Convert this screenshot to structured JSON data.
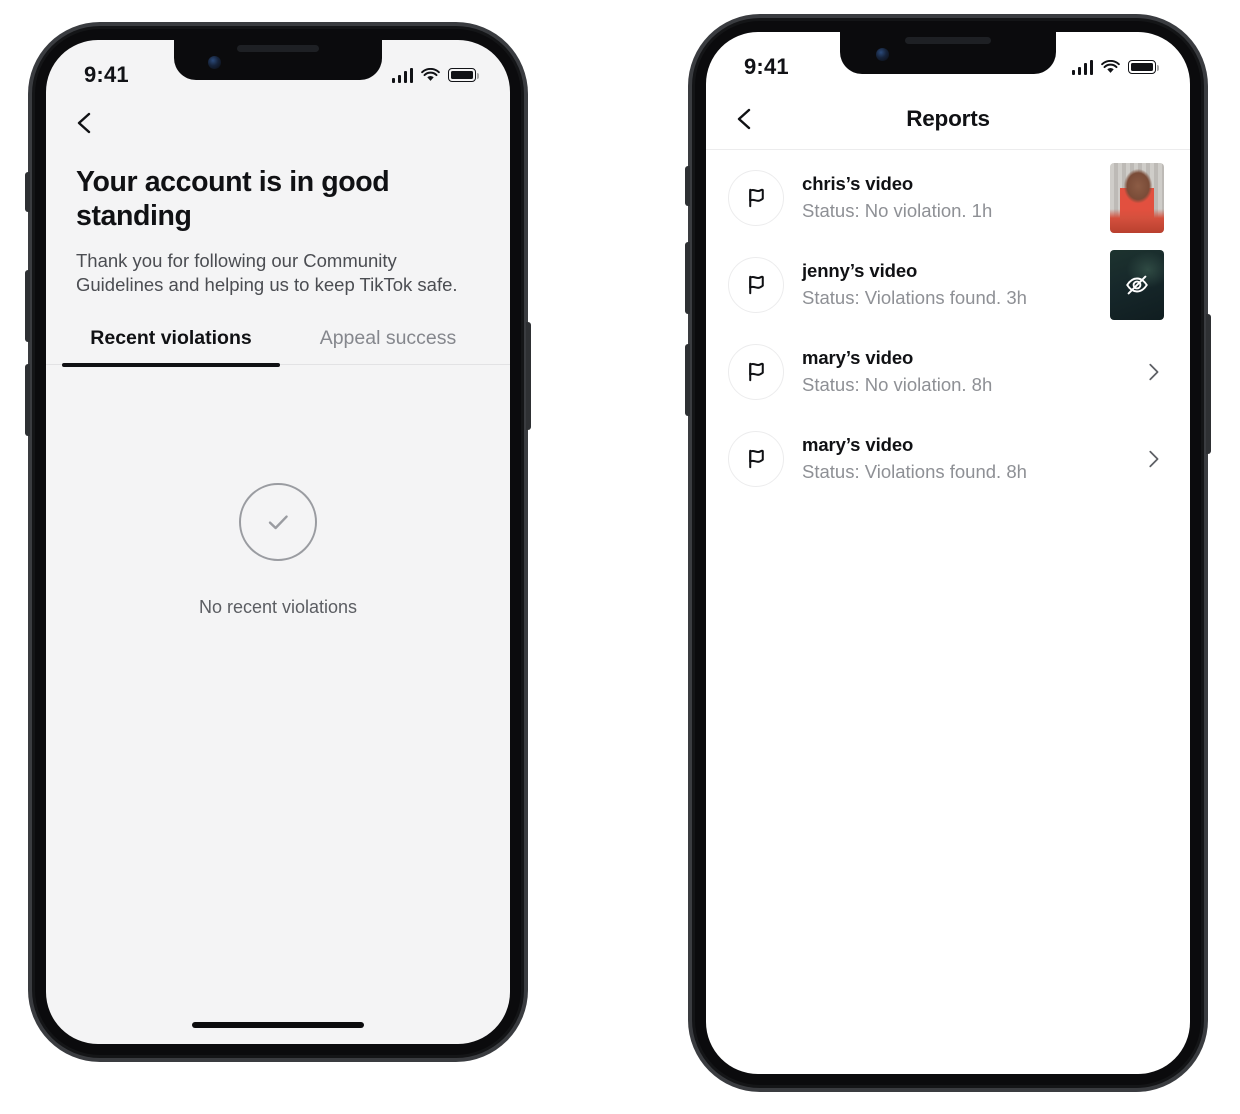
{
  "phones": {
    "left": {
      "status": {
        "time": "9:41",
        "signal_icon": "cellular-bars-icon",
        "wifi_icon": "wifi-icon",
        "battery_icon": "battery-full-icon"
      },
      "back_icon": "chevron-left-icon",
      "headline": "Your account is in good standing",
      "subline": "Thank you for following our Community Guidelines and helping us to keep TikTok safe.",
      "tabs": [
        {
          "label": "Recent violations",
          "active": true
        },
        {
          "label": "Appeal success",
          "active": false
        }
      ],
      "empty_state": {
        "icon": "check-circle-icon",
        "label": "No recent violations"
      },
      "home_indicator": true
    },
    "right": {
      "status": {
        "time": "9:41",
        "signal_icon": "cellular-bars-icon",
        "wifi_icon": "wifi-icon",
        "battery_icon": "battery-full-icon"
      },
      "nav": {
        "back_icon": "chevron-left-icon",
        "title": "Reports"
      },
      "rows": [
        {
          "icon": "flag-icon",
          "title": "chris’s video",
          "status": "Status: No violation.",
          "time": "1h",
          "trailing": "thumbnail",
          "thumbnail": "chris-video-thumbnail",
          "hidden_overlay": false
        },
        {
          "icon": "flag-icon",
          "title": "jenny’s video",
          "status": "Status: Violations found.",
          "time": "3h",
          "trailing": "thumbnail",
          "thumbnail": "jenny-video-thumbnail",
          "hidden_overlay": true,
          "overlay_icon": "eye-off-icon"
        },
        {
          "icon": "flag-icon",
          "title": "mary’s video",
          "status": "Status: No violation.",
          "time": "8h",
          "trailing": "chevron",
          "chevron_icon": "chevron-right-icon"
        },
        {
          "icon": "flag-icon",
          "title": "mary’s video",
          "status": "Status: Violations found.",
          "time": "8h",
          "trailing": "chevron",
          "chevron_icon": "chevron-right-icon"
        }
      ],
      "home_indicator": false
    }
  },
  "colors": {
    "screen_bg_left": "#f4f4f5",
    "screen_bg_right": "#ffffff",
    "text_primary": "#101114",
    "text_secondary": "#8e9095",
    "tab_inactive": "#85878d",
    "divider": "#ececed",
    "frame": "#141517"
  }
}
